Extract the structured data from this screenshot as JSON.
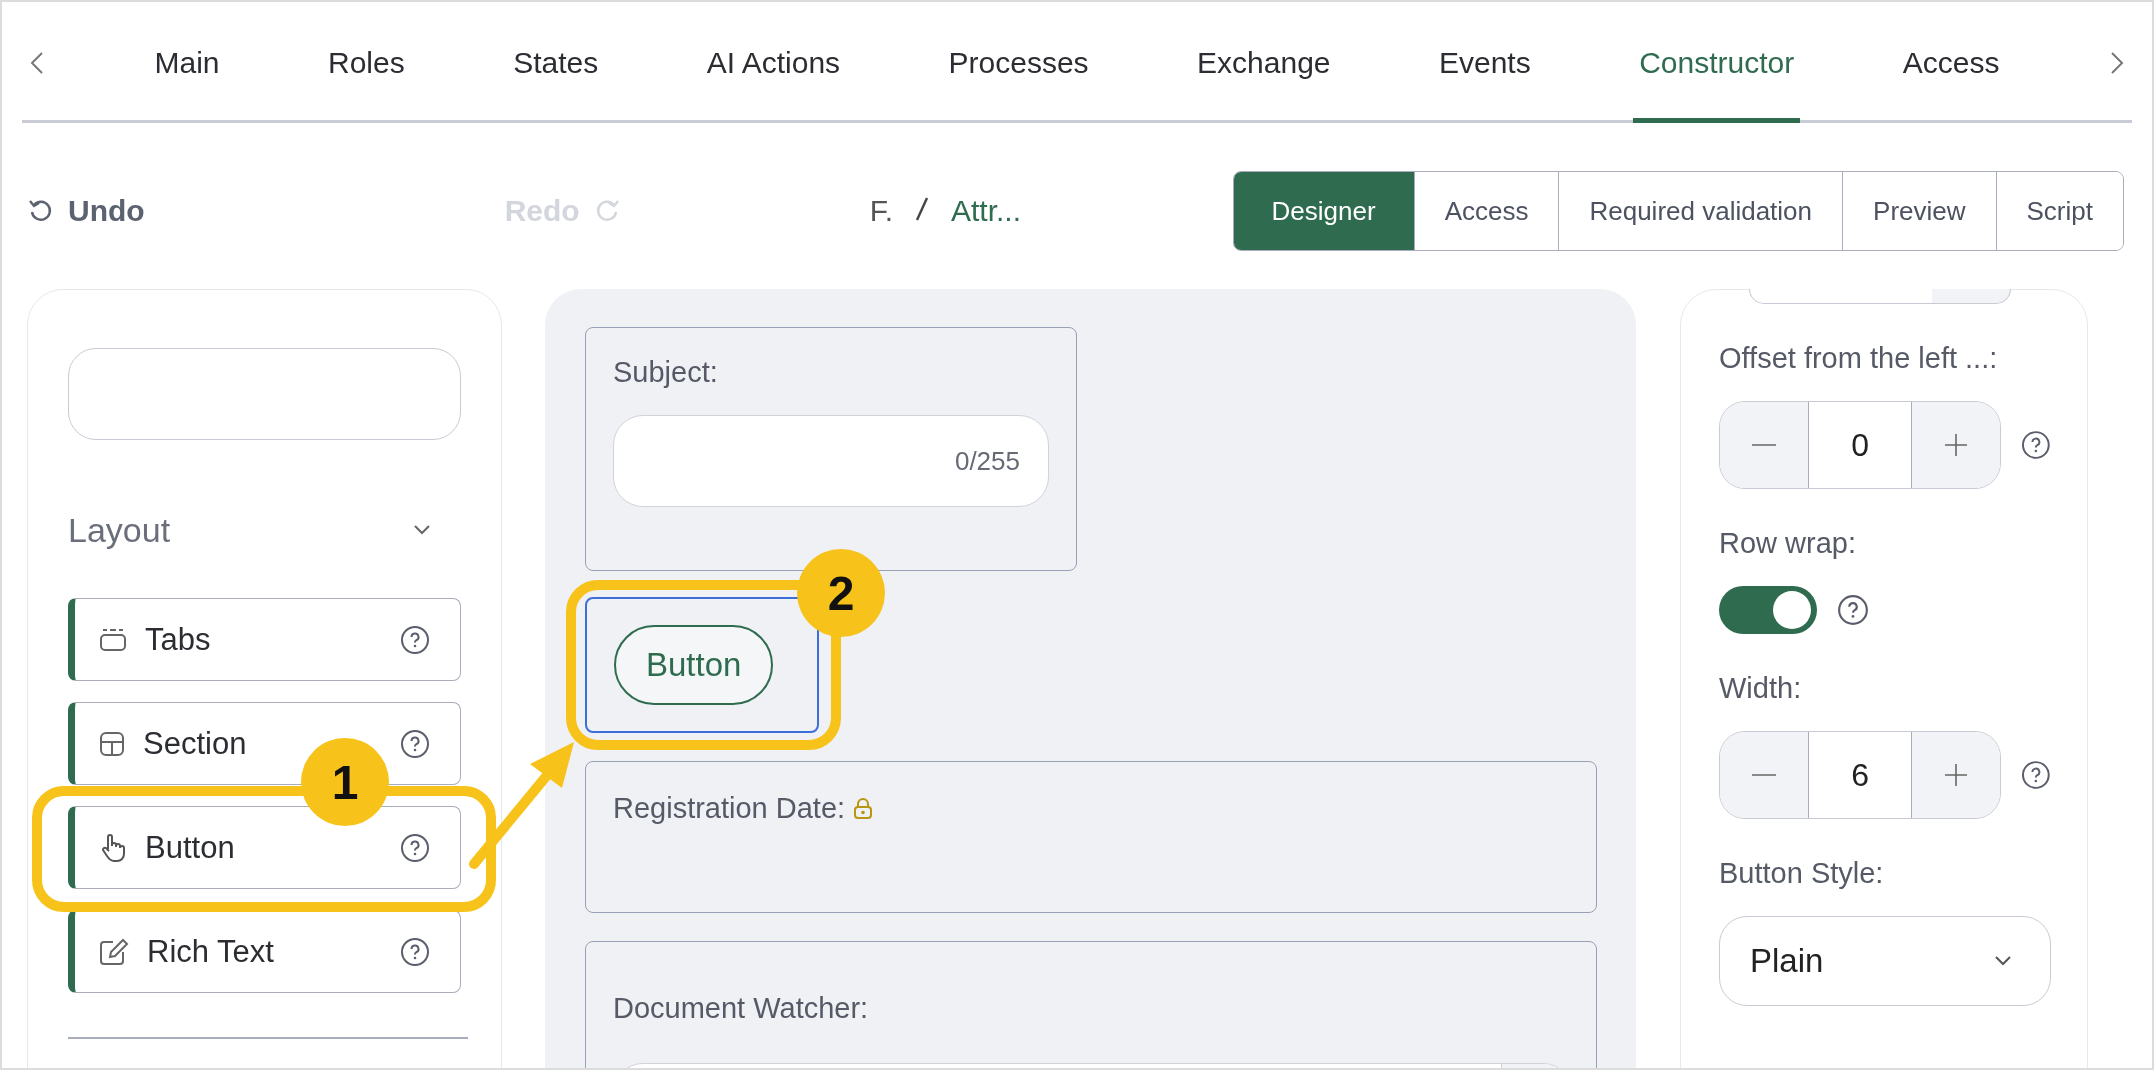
{
  "nav_tabs": [
    {
      "label": "Main",
      "selected": false
    },
    {
      "label": "Roles",
      "selected": false
    },
    {
      "label": "States",
      "selected": false
    },
    {
      "label": "AI Actions",
      "selected": false
    },
    {
      "label": "Processes",
      "selected": false
    },
    {
      "label": "Exchange",
      "selected": false
    },
    {
      "label": "Events",
      "selected": false
    },
    {
      "label": "Constructor",
      "selected": true
    },
    {
      "label": "Access",
      "selected": false
    }
  ],
  "toolbar": {
    "undo": {
      "label": "Undo",
      "disabled": false
    },
    "redo": {
      "label": "Redo",
      "disabled": true
    },
    "breadcrumb": [
      "F.",
      "Attr..."
    ],
    "view_tabs": [
      {
        "label": "Designer",
        "selected": true
      },
      {
        "label": "Access",
        "selected": false
      },
      {
        "label": "Required validation",
        "selected": false
      },
      {
        "label": "Preview",
        "selected": false
      },
      {
        "label": "Script",
        "selected": false
      }
    ]
  },
  "components": {
    "group": {
      "title": "Layout",
      "expanded": true
    },
    "items": [
      {
        "kind": "tabs",
        "label": "Tabs"
      },
      {
        "kind": "section",
        "label": "Section"
      },
      {
        "kind": "button",
        "label": "Button",
        "callout": "1"
      },
      {
        "kind": "rich_text",
        "label": "Rich Text"
      }
    ]
  },
  "canvas": {
    "fields": [
      {
        "kind": "text",
        "label": "Subject:",
        "counter": "0/255"
      },
      {
        "kind": "button",
        "label": "Button",
        "selected": true,
        "callout": "2"
      },
      {
        "kind": "date",
        "label": "Registration Date:",
        "locked": true
      },
      {
        "kind": "select",
        "label": "Document Watcher:"
      }
    ]
  },
  "properties": [
    {
      "kind": "stepper",
      "label": "Offset from the left ...:",
      "value": "0"
    },
    {
      "kind": "toggle",
      "label": "Row wrap:",
      "on": true
    },
    {
      "kind": "stepper",
      "label": "Width:",
      "value": "6"
    },
    {
      "kind": "select",
      "label": "Button Style:",
      "value": "Plain"
    }
  ]
}
